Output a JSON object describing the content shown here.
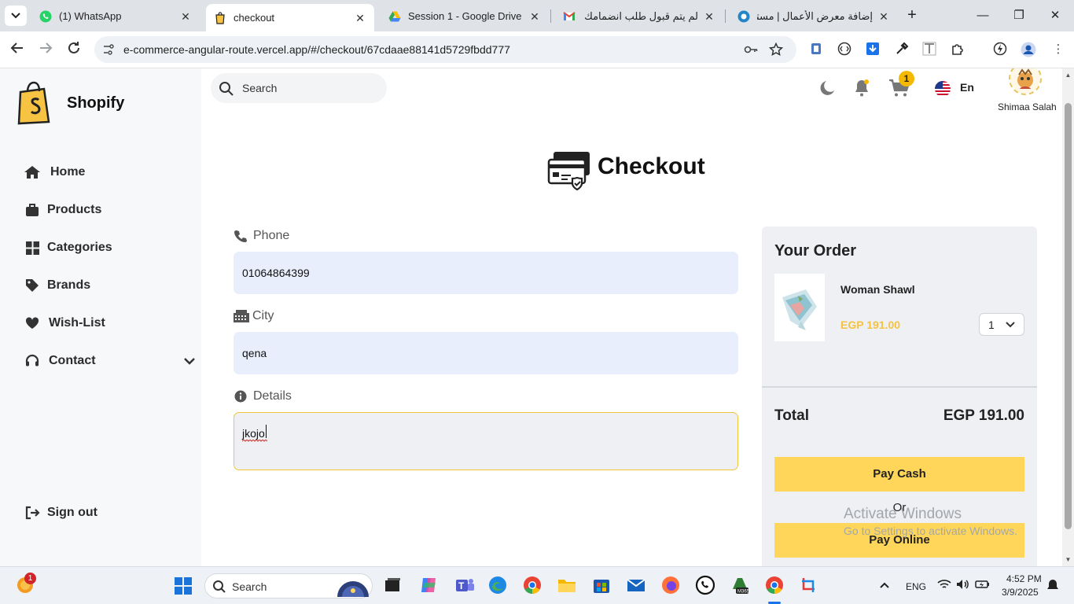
{
  "browser": {
    "tabs": [
      {
        "title": "(1) WhatsApp"
      },
      {
        "title": "checkout"
      },
      {
        "title": "Session 1 - Google Drive"
      },
      {
        "title": "لم يتم قبول طلب انضمامك -"
      },
      {
        "title": "إضافة معرض الأعمال | مستقل"
      }
    ],
    "url": "e-commerce-angular-route.vercel.app/#/checkout/67cdaae88141d5729fbdd777"
  },
  "sidebar": {
    "brand": "Shopify",
    "items": [
      {
        "label": "Home",
        "icon": "home-icon"
      },
      {
        "label": "Products",
        "icon": "briefcase-icon"
      },
      {
        "label": "Categories",
        "icon": "grid-icon"
      },
      {
        "label": "Brands",
        "icon": "tag-icon"
      },
      {
        "label": "Wish-List",
        "icon": "heart-icon"
      },
      {
        "label": "Contact",
        "icon": "headset-icon"
      }
    ],
    "signout": "Sign out"
  },
  "header": {
    "search_placeholder": "Search",
    "cart_count": "1",
    "language": "En",
    "user_name": "Shimaa Salah"
  },
  "checkout": {
    "title": "Checkout",
    "phone_label": "Phone",
    "phone_value": "01064864399",
    "city_label": "City",
    "city_value": "qena",
    "details_label": "Details",
    "details_value": "jkojo"
  },
  "order": {
    "title": "Your Order",
    "product_name": "Woman Shawl",
    "product_price": "EGP 191.00",
    "quantity": "1",
    "total_label": "Total",
    "total_value": "EGP 191.00",
    "pay_cash": "Pay Cash",
    "or": "Or",
    "pay_online": "Pay Online"
  },
  "overlay": {
    "activate_title": "Activate Windows",
    "activate_sub": "Go to Settings to activate Windows."
  },
  "taskbar": {
    "search": "Search",
    "notification_count": "1",
    "language": "ENG",
    "time": "4:52 PM",
    "date": "3/9/2025"
  },
  "colors": {
    "accent": "#ffd659",
    "price": "#f5c242",
    "field_bg": "#e8eefc"
  }
}
